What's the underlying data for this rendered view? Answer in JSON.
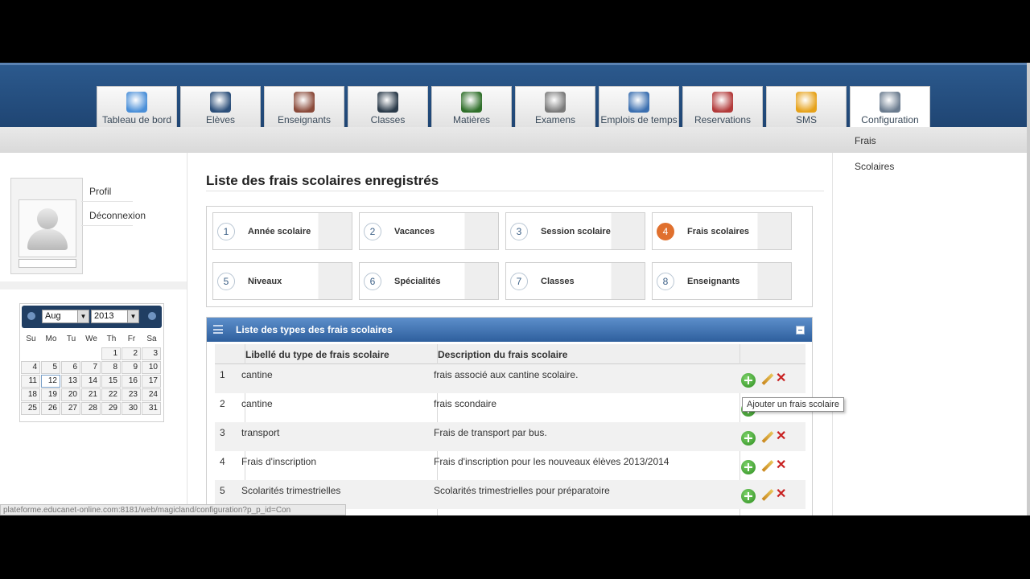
{
  "nav": {
    "tabs": [
      {
        "label": "Tableau de bord",
        "icon": "dashboard-icon",
        "color": "#4a8fd8"
      },
      {
        "label": "Elèves",
        "icon": "student-icon",
        "color": "#2c4f7a"
      },
      {
        "label": "Enseignants",
        "icon": "teachers-icon",
        "color": "#8a4a3a"
      },
      {
        "label": "Classes",
        "icon": "classroom-icon",
        "color": "#2b3b4a"
      },
      {
        "label": "Matières",
        "icon": "subjects-icon",
        "color": "#2f6f2a"
      },
      {
        "label": "Examens",
        "icon": "exams-icon",
        "color": "#7a7a7a"
      },
      {
        "label": "Emplois de temps",
        "icon": "calendar-clock-icon",
        "color": "#3b6fb0"
      },
      {
        "label": "Reservations",
        "icon": "reservation-icon",
        "color": "#b23a3a"
      },
      {
        "label": "SMS",
        "icon": "sms-icon",
        "color": "#e6a21a"
      },
      {
        "label": "Configuration",
        "icon": "configuration-icon",
        "color": "#6b7c8f"
      }
    ],
    "active_index": 9
  },
  "subbar": {
    "link": "Frais"
  },
  "sidebar": {
    "profile_link": "Profil",
    "logout_link": "Déconnexion"
  },
  "calendar": {
    "month": "Aug",
    "year": "2013",
    "days_of_week": [
      "Su",
      "Mo",
      "Tu",
      "We",
      "Th",
      "Fr",
      "Sa"
    ],
    "weeks": [
      [
        "",
        "",
        "",
        "",
        "1",
        "2",
        "3"
      ],
      [
        "4",
        "5",
        "6",
        "7",
        "8",
        "9",
        "10"
      ],
      [
        "11",
        "12",
        "13",
        "14",
        "15",
        "16",
        "17"
      ],
      [
        "18",
        "19",
        "20",
        "21",
        "22",
        "23",
        "24"
      ],
      [
        "25",
        "26",
        "27",
        "28",
        "29",
        "30",
        "31"
      ]
    ],
    "today": "12"
  },
  "main": {
    "title": "Liste des frais scolaires enregistrés",
    "steps": [
      {
        "num": "1",
        "label": "Année scolaire"
      },
      {
        "num": "2",
        "label": "Vacances"
      },
      {
        "num": "3",
        "label": "Session scolaire"
      },
      {
        "num": "4",
        "label": "Frais scolaires",
        "active": true
      },
      {
        "num": "5",
        "label": "Niveaux"
      },
      {
        "num": "6",
        "label": "Spécialités"
      },
      {
        "num": "7",
        "label": "Classes"
      },
      {
        "num": "8",
        "label": "Enseignants"
      }
    ],
    "panel_title": "Liste des types des frais scolaires",
    "table": {
      "headers": [
        "Libellé du type de frais scolaire",
        "Description du frais scolaire"
      ],
      "rows": [
        {
          "num": "1",
          "label": "cantine",
          "description": "frais associé aux cantine scolaire."
        },
        {
          "num": "2",
          "label": "cantine",
          "description": "frais scondaire"
        },
        {
          "num": "3",
          "label": "transport",
          "description": "Frais de transport par bus."
        },
        {
          "num": "4",
          "label": "Frais d'inscription",
          "description": "Frais d'inscription pour les nouveaux élèves 2013/2014"
        },
        {
          "num": "5",
          "label": "Scolarités trimestrielles",
          "description": "Scolarités trimestrielles pour préparatoire"
        }
      ]
    }
  },
  "tooltip": "Ajouter un frais scolaire",
  "right_sidebar": {
    "link": "Scolaires"
  },
  "status_bar": "plateforme.educanet-online.com:8181/web/magicland/configuration?p_p_id=Con",
  "colors": {
    "header": "#2c5a8e",
    "panel_header": "#3f73b4",
    "active_step": "#e0702e",
    "add": "#2d8d1f",
    "delete": "#c82020"
  }
}
